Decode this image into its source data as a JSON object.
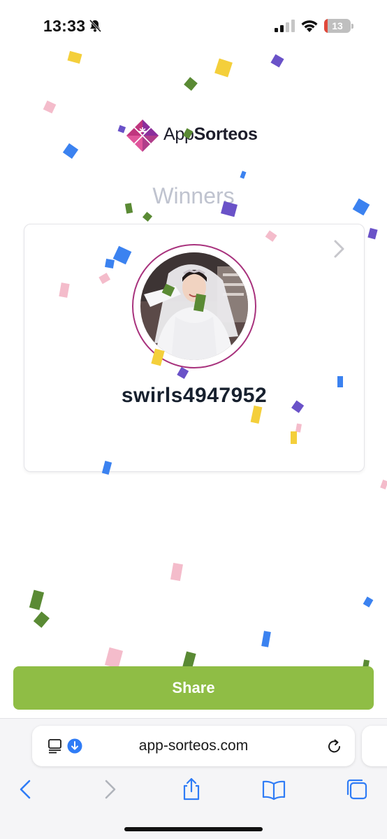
{
  "status_bar": {
    "time": "13:33",
    "battery_level": "13",
    "battery_fraction": 0.13,
    "icons": [
      "bell-slash-icon",
      "cellular-signal-icon",
      "wifi-icon",
      "battery-icon"
    ],
    "battery_color": "#e0483a"
  },
  "logo": {
    "text_light": "App",
    "text_bold": "Sorteos"
  },
  "page": {
    "title": "Winners"
  },
  "winner": {
    "username": "swirls4947952"
  },
  "actions": {
    "share_label": "Share"
  },
  "browser": {
    "url": "app-sorteos.com",
    "icons": [
      "reader-icon",
      "download-icon",
      "reload-icon",
      "back-icon",
      "forward-icon",
      "share-icon",
      "bookmarks-icon",
      "tabs-icon"
    ]
  },
  "colors": {
    "share_green": "#8fbd45",
    "avatar_ring": "#a8327d",
    "title_gray": "#bfc3cf",
    "ios_blue": "#2f7cf6"
  }
}
